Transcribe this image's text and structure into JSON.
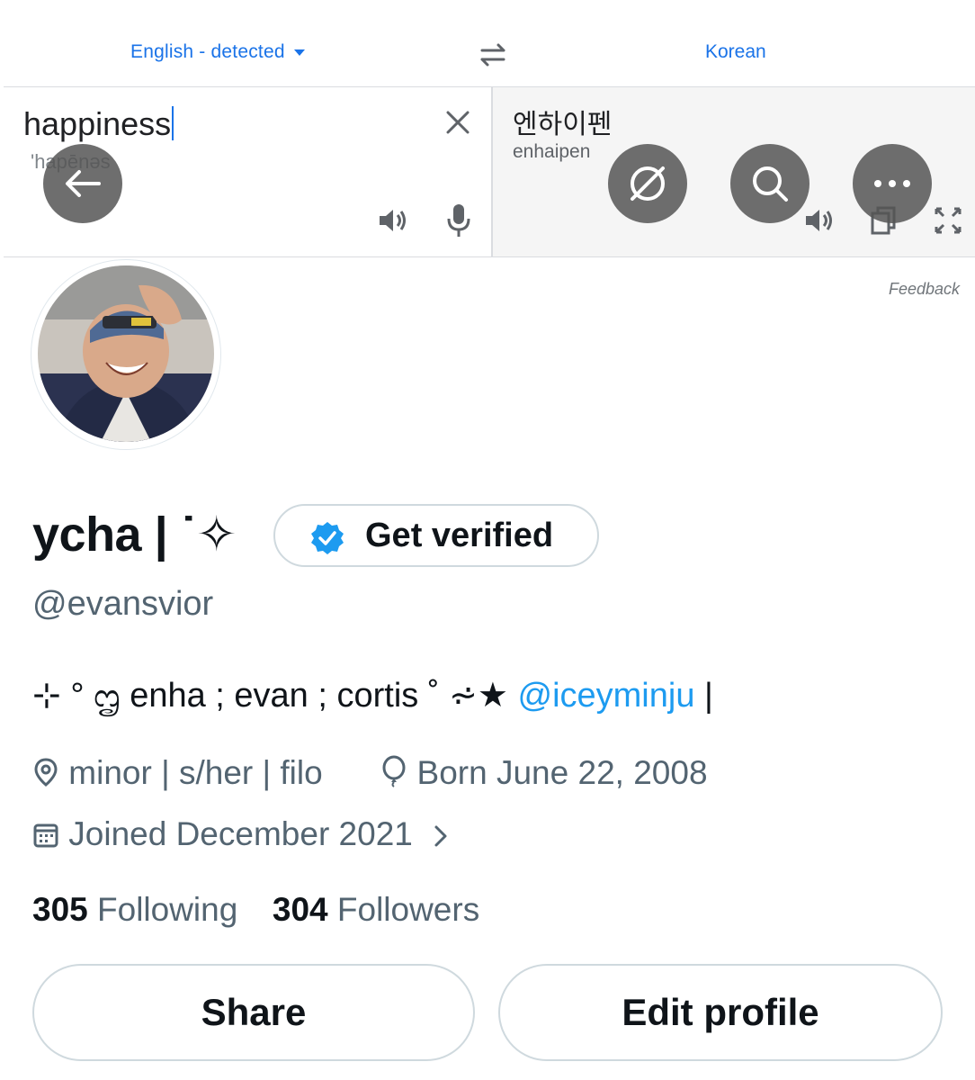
{
  "translator": {
    "source_language": "English - detected",
    "target_language": "Korean",
    "source_text": "happiness",
    "source_transliteration": "'hapēnəs",
    "translated_text": "엔하이펜",
    "translated_transliteration": "enhaipen",
    "feedback_label": "Feedback",
    "icons": [
      "chevron-down-icon",
      "swap-icon",
      "close-icon",
      "speaker-icon",
      "mic-icon",
      "copy-icon",
      "expand-icon"
    ]
  },
  "overlay": {
    "icons": [
      "back-arrow-icon",
      "no-compass-icon",
      "search-icon",
      "more-icon"
    ],
    "fab_color": "#555555"
  },
  "profile": {
    "display_name": "ycha | ˙✧",
    "get_verified_label": "Get verified",
    "handle": "@evansvior",
    "bio": {
      "text": "⊹ ° ᦗ enha ; evan ; cortis ˚ ⩫★ ",
      "mention": "@iceyminju",
      "suffix": " |"
    },
    "location": "minor | s/her | filo",
    "birthday": "Born June 22, 2008",
    "joined": "Joined December 2021",
    "following_count": "305",
    "following_label": "Following",
    "followers_count": "304",
    "followers_label": "Followers",
    "share_label": "Share",
    "edit_profile_label": "Edit profile"
  },
  "colors": {
    "link_blue": "#1d9bf0",
    "translate_blue": "#1a73e8",
    "secondary_text": "#536471",
    "primary_text": "#0f1419",
    "border": "#cfd9de"
  }
}
